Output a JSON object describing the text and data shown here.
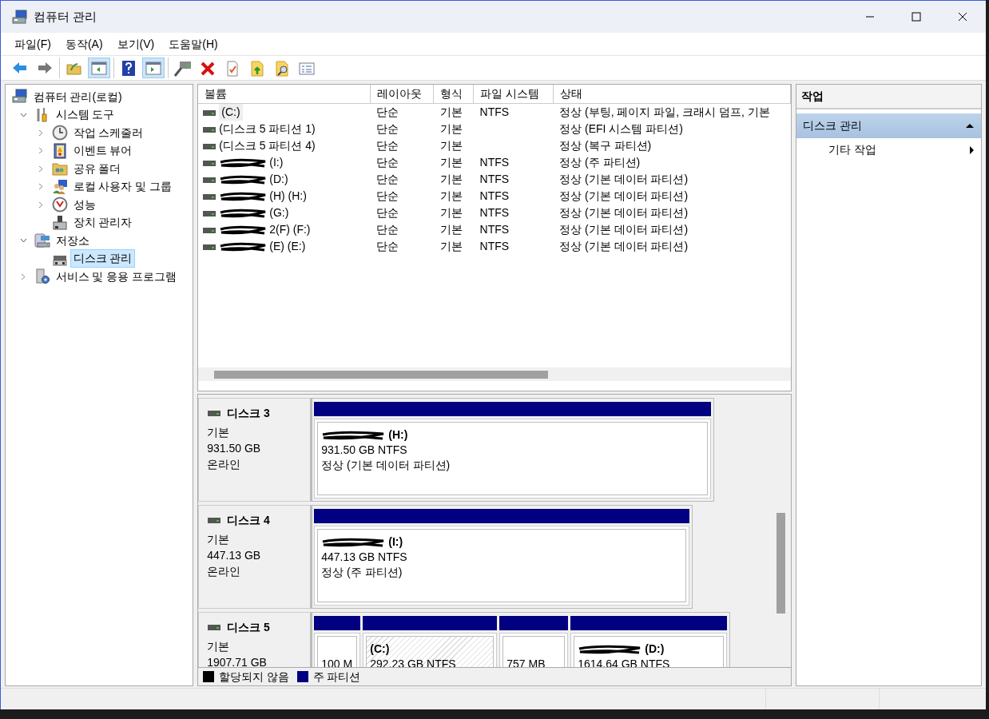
{
  "window": {
    "title": "컴퓨터 관리"
  },
  "menu": [
    "파일(F)",
    "동작(A)",
    "보기(V)",
    "도움말(H)"
  ],
  "toolbar": [
    [
      {
        "pressed": false
      },
      {
        "pressed": false
      }
    ],
    [
      {
        "pressed": false
      },
      {
        "pressed": true
      }
    ],
    [
      {
        "pressed": false
      },
      {
        "pressed": true
      }
    ],
    [
      {
        "pressed": false
      },
      {
        "pressed": false
      },
      {
        "pressed": false
      },
      {
        "pressed": false
      },
      {
        "pressed": false
      },
      {
        "pressed": false
      }
    ]
  ],
  "tree": [
    {
      "label": "컴퓨터 관리(로컬)",
      "selected": false,
      "children": [
        {
          "label": "시스템 도구",
          "expanded": true,
          "selected": false,
          "children": [
            {
              "label": "작업 스케줄러",
              "expanded": false,
              "selected": false
            },
            {
              "label": "이벤트 뷰어",
              "expanded": false,
              "selected": false
            },
            {
              "label": "공유 폴더",
              "expanded": false,
              "selected": false
            },
            {
              "label": "로컬 사용자 및 그룹",
              "expanded": false,
              "selected": false
            },
            {
              "label": "성능",
              "expanded": false,
              "selected": false
            },
            {
              "label": "장치 관리자",
              "selected": false
            }
          ]
        },
        {
          "label": "저장소",
          "expanded": true,
          "selected": false,
          "children": [
            {
              "label": "디스크 관리",
              "selected": true
            }
          ]
        },
        {
          "label": "서비스 및 응용 프로그램",
          "expanded": false,
          "selected": false
        }
      ]
    }
  ],
  "volumes": {
    "columns": [
      "볼륨",
      "레이아웃",
      "형식",
      "파일 시스템",
      "상태"
    ],
    "rows": [
      {
        "cells": [
          "(C:)",
          "단순",
          "기본",
          "NTFS",
          "정상 (부팅, 페이지 파일, 크래시 덤프, 기본"
        ],
        "redacted": false,
        "selected": true
      },
      {
        "cells": [
          "(디스크 5 파티션 1)",
          "단순",
          "기본",
          "",
          "정상 (EFI 시스템 파티션)"
        ],
        "redacted": false,
        "selected": false
      },
      {
        "cells": [
          "(디스크 5 파티션 4)",
          "단순",
          "기본",
          "",
          "정상 (복구 파티션)"
        ],
        "redacted": false,
        "selected": false
      },
      {
        "cells": [
          "(I:)",
          "단순",
          "기본",
          "NTFS",
          "정상 (주 파티션)"
        ],
        "redacted": true,
        "selected": false
      },
      {
        "cells": [
          "(D:)",
          "단순",
          "기본",
          "NTFS",
          "정상 (기본 데이터 파티션)"
        ],
        "redacted": true,
        "selected": false
      },
      {
        "cells": [
          "(H) (H:)",
          "단순",
          "기본",
          "NTFS",
          "정상 (기본 데이터 파티션)"
        ],
        "redacted": true,
        "selected": false
      },
      {
        "cells": [
          "(G:)",
          "단순",
          "기본",
          "NTFS",
          "정상 (기본 데이터 파티션)"
        ],
        "redacted": true,
        "selected": false
      },
      {
        "cells": [
          "2(F) (F:)",
          "단순",
          "기본",
          "NTFS",
          "정상 (기본 데이터 파티션)"
        ],
        "redacted": true,
        "selected": false
      },
      {
        "cells": [
          "(E) (E:)",
          "단순",
          "기본",
          "NTFS",
          "정상 (기본 데이터 파티션)"
        ],
        "redacted": true,
        "selected": false
      }
    ]
  },
  "disks": [
    {
      "name": "디스크 3",
      "type": "기본",
      "size": "931.50 GB",
      "status": "온라인",
      "partitions": [
        {
          "name": "(H:)",
          "size": "931.50 GB NTFS",
          "status": "정상 (기본 데이터 파티션)",
          "redacted": true,
          "selected": false
        }
      ]
    },
    {
      "name": "디스크 4",
      "type": "기본",
      "size": "447.13 GB",
      "status": "온라인",
      "partitions": [
        {
          "name": "(I:)",
          "size": "447.13 GB NTFS",
          "status": "정상 (주 파티션)",
          "redacted": true,
          "selected": false
        }
      ]
    },
    {
      "name": "디스크 5",
      "type": "기본",
      "size": "1907.71 GB",
      "partitions": [
        {
          "size": "100 M",
          "selected": false
        },
        {
          "name": "(C:)",
          "size": "292.23 GB NTFS",
          "redacted": false,
          "selected": true
        },
        {
          "size": "757 MB",
          "selected": false
        },
        {
          "name": "(D:)",
          "size": "1614.64 GB NTFS",
          "redacted": true,
          "selected": false
        }
      ]
    }
  ],
  "legend": [
    {
      "label": "할당되지 않음",
      "color": "#000000"
    },
    {
      "label": "주 파티션",
      "color": "#000080"
    }
  ],
  "actions": {
    "title": "작업",
    "sections": [
      {
        "label": "디스크 관리",
        "expanded": true,
        "items": [
          "기타 작업"
        ]
      }
    ]
  }
}
